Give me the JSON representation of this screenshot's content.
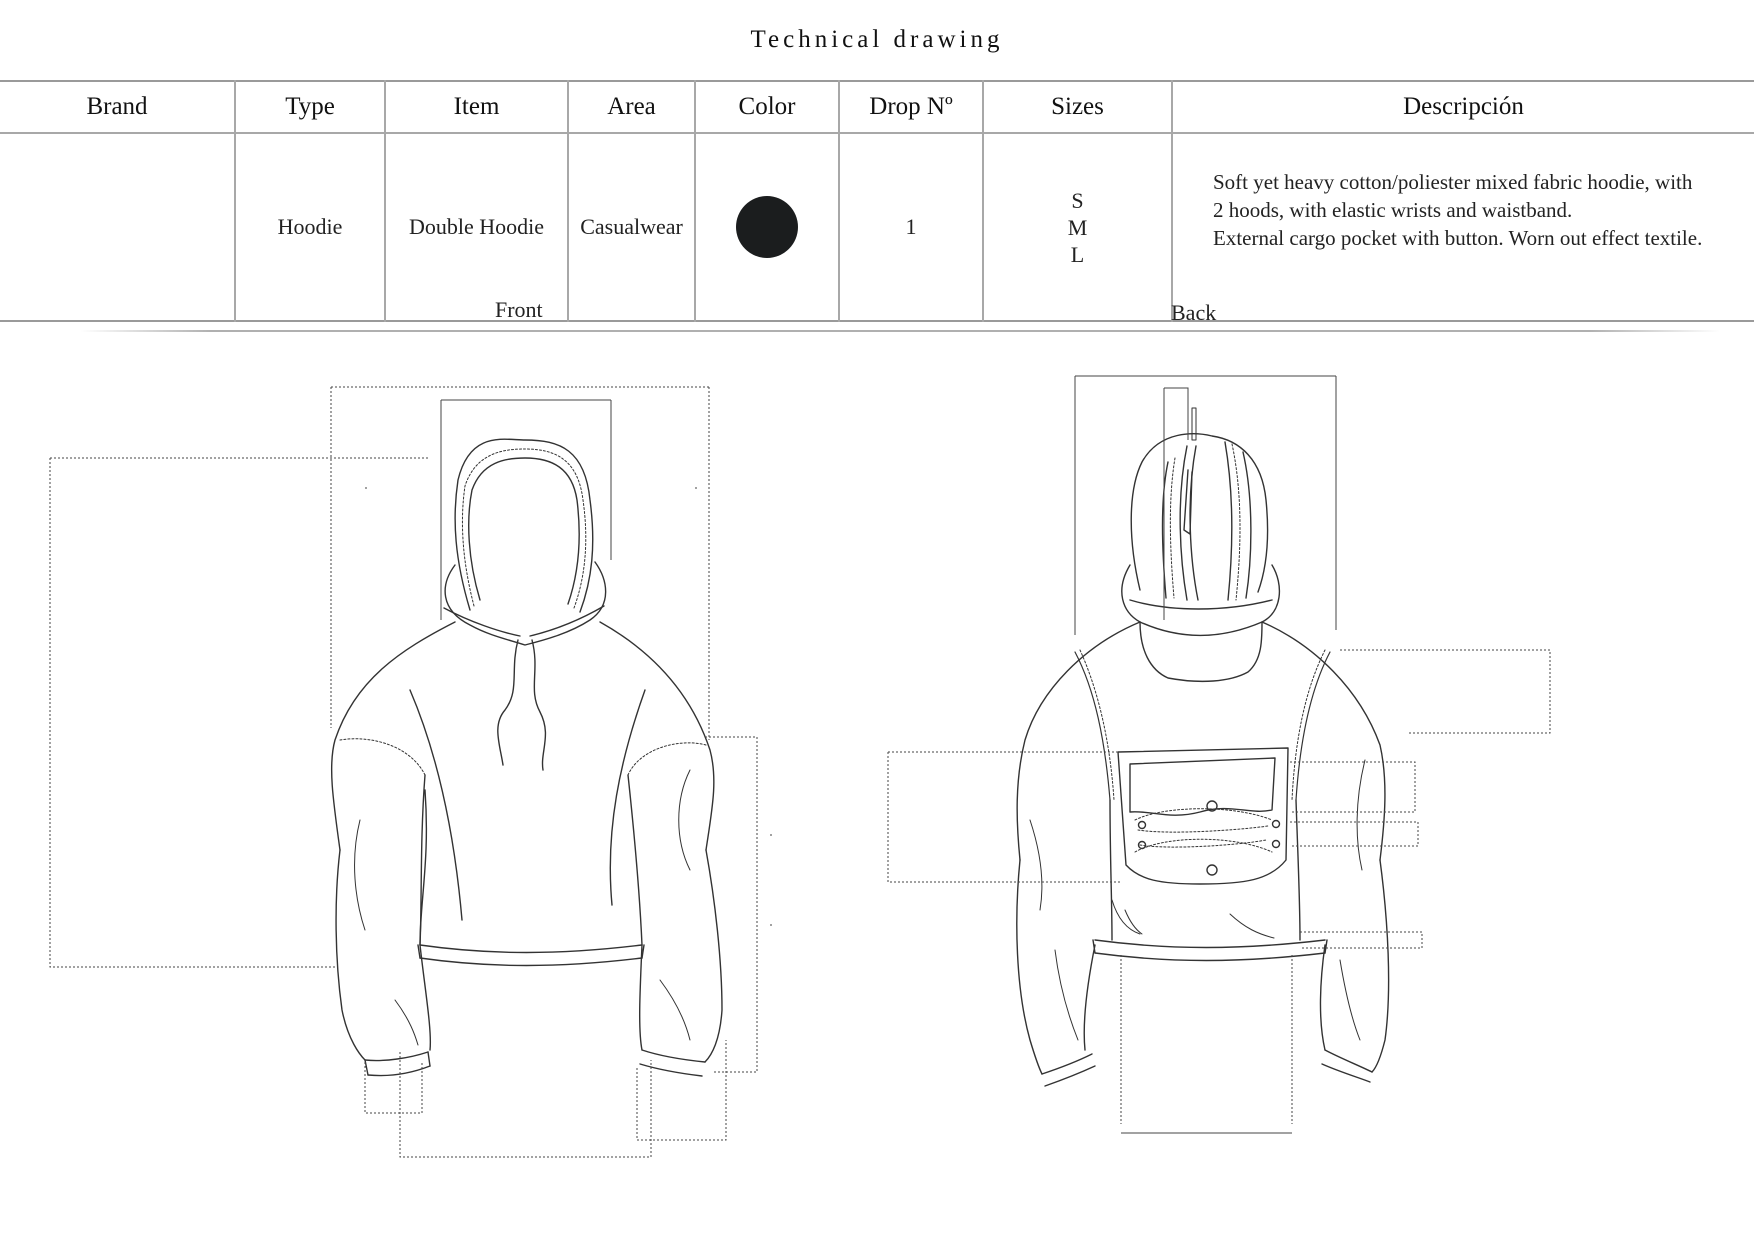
{
  "title": "Technical drawing",
  "table": {
    "headers": [
      "Brand",
      "Type",
      "Item",
      "Area",
      "Color",
      "Drop Nº",
      "Sizes",
      "Descripción"
    ],
    "row": {
      "brand": "",
      "type": "Hoodie",
      "item": "Double Hoodie",
      "area": "Casualwear",
      "color": "#1b1d1e",
      "drop": "1",
      "sizes": [
        "S",
        "M",
        "L"
      ],
      "description": [
        "Soft yet heavy cotton/poliester mixed fabric hoodie, with",
        "2 hoods, with elastic wrists and waistband.",
        "External cargo pocket with button. Worn out effect textile."
      ]
    }
  },
  "views": {
    "front": "Front",
    "back": "Back"
  }
}
